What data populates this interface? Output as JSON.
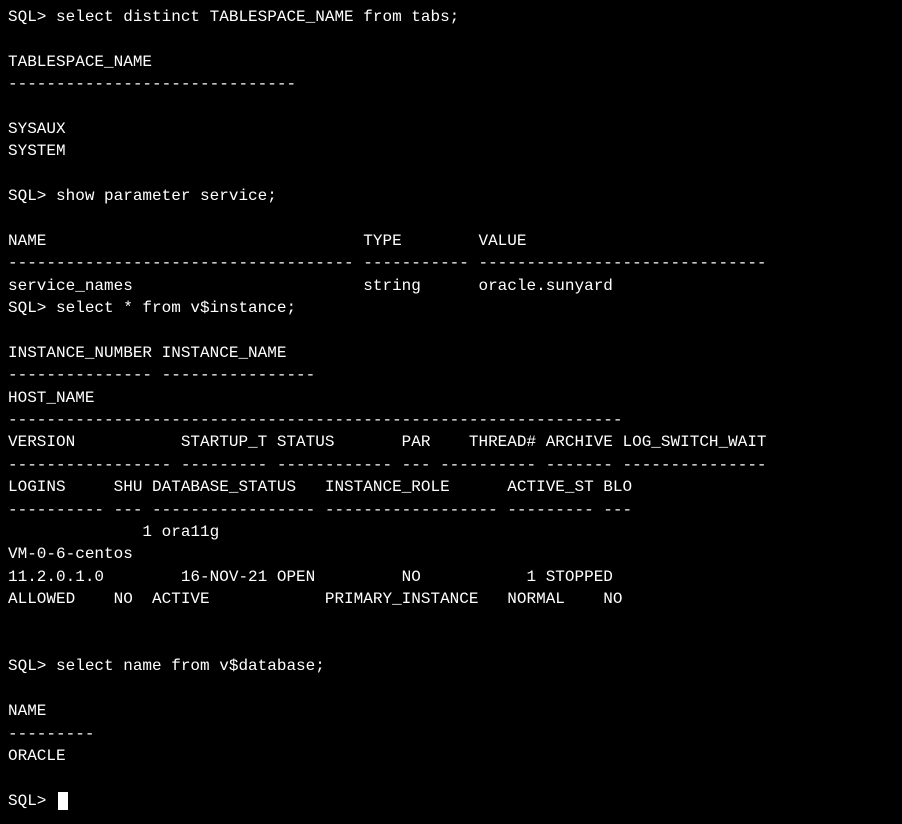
{
  "lines": {
    "l1": "SQL> select distinct TABLESPACE_NAME from tabs;",
    "l2": "",
    "l3": "TABLESPACE_NAME",
    "l4": "------------------------------",
    "l5": "",
    "l6": "SYSAUX",
    "l7": "SYSTEM",
    "l8": "",
    "l9": "SQL> show parameter service;",
    "l10": "",
    "l11": "NAME                                 TYPE        VALUE",
    "l12": "------------------------------------ ----------- ------------------------------",
    "l13": "service_names                        string      oracle.sunyard",
    "l14": "SQL> select * from v$instance;",
    "l15": "",
    "l16": "INSTANCE_NUMBER INSTANCE_NAME",
    "l17": "--------------- ----------------",
    "l18": "HOST_NAME",
    "l19": "----------------------------------------------------------------",
    "l20": "VERSION           STARTUP_T STATUS       PAR    THREAD# ARCHIVE LOG_SWITCH_WAIT",
    "l21": "----------------- --------- ------------ --- ---------- ------- ---------------",
    "l22": "LOGINS     SHU DATABASE_STATUS   INSTANCE_ROLE      ACTIVE_ST BLO",
    "l23": "---------- --- ----------------- ------------------ --------- ---",
    "l24": "              1 ora11g",
    "l25": "VM-0-6-centos",
    "l26": "11.2.0.1.0        16-NOV-21 OPEN         NO           1 STOPPED",
    "l27": "ALLOWED    NO  ACTIVE            PRIMARY_INSTANCE   NORMAL    NO",
    "l28": "",
    "l29": "",
    "l30": "SQL> select name from v$database;",
    "l31": "",
    "l32": "NAME",
    "l33": "---------",
    "l34": "ORACLE",
    "l35": "",
    "l36": "SQL> "
  }
}
